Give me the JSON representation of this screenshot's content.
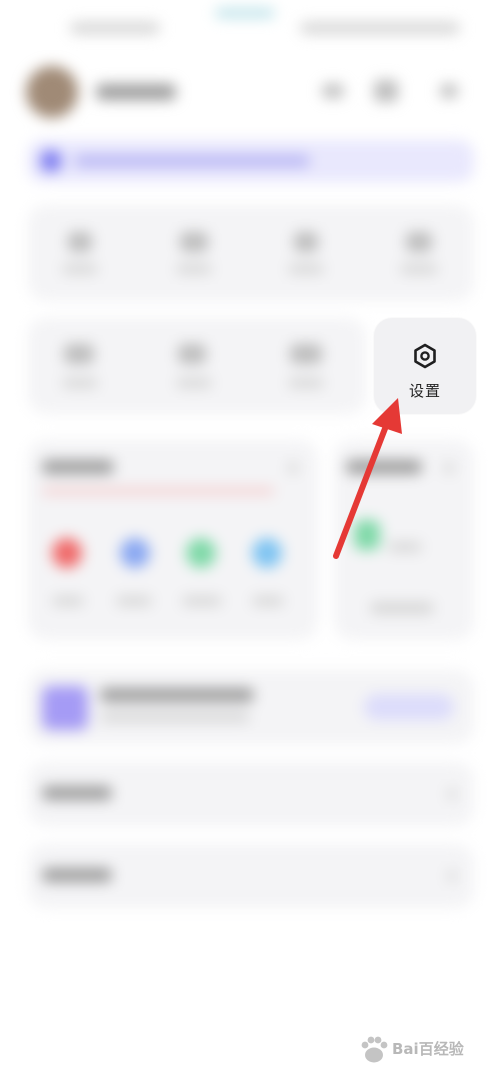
{
  "settings_tile": {
    "label": "设置",
    "icon": "hexagon-gear-icon"
  },
  "annotation": {
    "arrow_color": "#e53935"
  },
  "watermark": {
    "text": "Bai百经验",
    "icon": "paw-icon"
  },
  "colors": {
    "accent": "#7d7cf0",
    "banner_bg": "#e9e8fd",
    "red": "#f06a6a",
    "blue": "#8aa8f2",
    "green": "#7fd9a8",
    "sky": "#7fc4f2"
  }
}
